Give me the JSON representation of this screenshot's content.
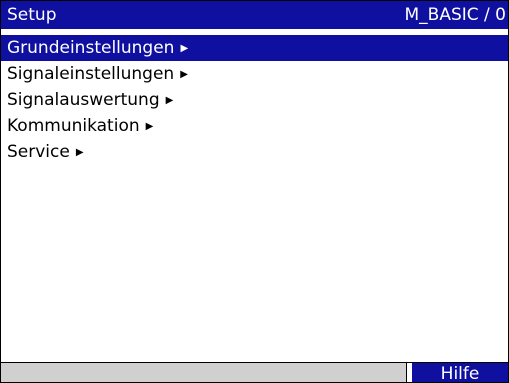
{
  "header": {
    "title": "Setup",
    "code": "M_BASIC / 0"
  },
  "menu": {
    "items": [
      {
        "label": "Grundeinstellungen",
        "arrow": "▶",
        "selected": true
      },
      {
        "label": "Signaleinstellungen",
        "arrow": "▶",
        "selected": false
      },
      {
        "label": "Signalauswertung",
        "arrow": "▶",
        "selected": false
      },
      {
        "label": "Kommunikation",
        "arrow": "▶",
        "selected": false
      },
      {
        "label": "Service",
        "arrow": "▶",
        "selected": false
      }
    ]
  },
  "footer": {
    "status_text": "",
    "softkey_label": "Hilfe"
  },
  "colors": {
    "accent": "#0f0fa0",
    "background": "#ffffff",
    "status_field": "#d0d0d0"
  }
}
